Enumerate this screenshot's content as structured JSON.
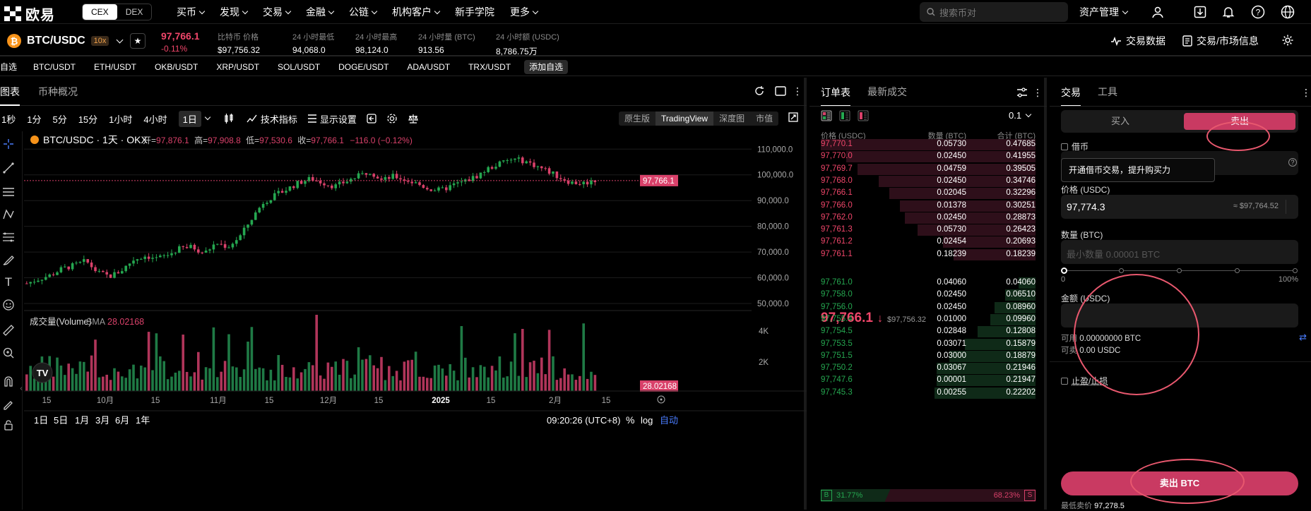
{
  "topbar": {
    "brand": "欧易",
    "cex": "CEX",
    "dex": "DEX",
    "nav": [
      "买币",
      "发现",
      "交易",
      "金融",
      "公链",
      "机构客户",
      "新手学院",
      "更多"
    ],
    "nav_has_chevron": [
      true,
      true,
      true,
      true,
      true,
      true,
      false,
      true
    ],
    "search_placeholder": "搜索币对",
    "asset_menu": "资产管理"
  },
  "ticker": {
    "pair": "BTC/USDC",
    "leverage": "10x",
    "last_price": "97,766.1",
    "change": "-0.11%",
    "stats": [
      {
        "label": "比特币 价格",
        "value": "$97,756.32"
      },
      {
        "label": "24 小时最低",
        "value": "94,068.0"
      },
      {
        "label": "24 小时最高",
        "value": "98,124.0"
      },
      {
        "label": "24 小时量 (BTC)",
        "value": "913.56"
      },
      {
        "label": "24 小时额 (USDC)",
        "value": "8,786.75万"
      }
    ],
    "trade_data": "交易数据",
    "trade_info": "交易/市场信息"
  },
  "watchlist": {
    "label": "自选",
    "pairs": [
      "BTC/USDT",
      "ETH/USDT",
      "OKB/USDT",
      "XRP/USDT",
      "SOL/USDT",
      "DOGE/USDT",
      "ADA/USDT",
      "TRX/USDT"
    ],
    "add": "添加自选"
  },
  "chart": {
    "tabs": [
      "图表",
      "币种概况"
    ],
    "timeframes": [
      "1秒",
      "1分",
      "5分",
      "15分",
      "1小时",
      "4小时"
    ],
    "active_timeframe": "1日",
    "indicators": "技术指标",
    "display_settings": "显示设置",
    "views": [
      "原生版",
      "TradingView",
      "深度图",
      "市值"
    ],
    "active_view": "TradingView",
    "legend": {
      "symbol": "BTC/USDC · 1天 · OKX",
      "open_label": "开=",
      "open": "97,876.1",
      "high_label": "高=",
      "high": "97,908.8",
      "low_label": "低=",
      "low": "97,530.6",
      "close_label": "收=",
      "close": "97,766.1",
      "change": "−116.0 (−0.12%)"
    },
    "volume_label": "成交量(Volume)",
    "volume_sma_label": "SMA",
    "volume_sma": "28.02168",
    "price_label": "97,766.1",
    "y_ticks": [
      "110,000.0",
      "100,000.0",
      "90,000.0",
      "80,000.0",
      "70,000.0",
      "60,000.0",
      "50,000.0"
    ],
    "vol_ticks": [
      "4K",
      "2K"
    ],
    "x_ticks": [
      "15",
      "10月",
      "15",
      "11月",
      "15",
      "12月",
      "15",
      "2025",
      "15",
      "2月",
      "15"
    ],
    "ranges": [
      "1日",
      "5日",
      "1月",
      "3月",
      "6月",
      "1年"
    ],
    "clock": "09:20:26 (UTC+8)",
    "percent": "%",
    "log": "log",
    "auto": "自动"
  },
  "chart_data": {
    "type": "candlestick",
    "title": "BTC/USDC · 1天 · OKX",
    "ylim": [
      50000,
      112000
    ],
    "x_range": [
      "2024-09",
      "2025-02"
    ],
    "approx_close_path": [
      57800,
      59500,
      61000,
      63500,
      64800,
      66500,
      62000,
      60500,
      62800,
      67000,
      68500,
      67500,
      69000,
      71500,
      72000,
      69500,
      73500,
      72000,
      76000,
      83000,
      89500,
      92000,
      94500,
      97000,
      98500,
      97000,
      95500,
      97500,
      99500,
      101500,
      97800,
      99500,
      98000,
      96500,
      94500,
      94000,
      96000,
      97500,
      99500,
      102500,
      104500,
      106000,
      105500,
      103500,
      101500,
      99000,
      97000,
      96800,
      97766
    ],
    "volume_color_up": "#1f7a45",
    "volume_color_down": "#b0355a",
    "up_color": "#25a750",
    "down_color": "#d9416a"
  },
  "orderbook": {
    "tabs": [
      "订单表",
      "最新成交"
    ],
    "precision": "0.1",
    "headers": [
      "价格 (USDC)",
      "数量 (BTC)",
      "合计 (BTC)"
    ],
    "asks": [
      [
        "97,770.1",
        "0.05730",
        "0.47685"
      ],
      [
        "97,770.0",
        "0.02450",
        "0.41955"
      ],
      [
        "97,769.7",
        "0.04759",
        "0.39505"
      ],
      [
        "97,768.0",
        "0.02450",
        "0.34746"
      ],
      [
        "97,766.1",
        "0.02045",
        "0.32296"
      ],
      [
        "97,766.0",
        "0.01378",
        "0.30251"
      ],
      [
        "97,762.0",
        "0.02450",
        "0.28873"
      ],
      [
        "97,761.3",
        "0.05730",
        "0.26423"
      ],
      [
        "97,761.2",
        "0.02454",
        "0.20693"
      ],
      [
        "97,761.1",
        "0.18239",
        "0.18239"
      ]
    ],
    "ask_depth": [
      1.0,
      0.88,
      0.83,
      0.73,
      0.68,
      0.63,
      0.61,
      0.55,
      0.43,
      0.38
    ],
    "mid_price": "97,766.1",
    "mid_usd": "$97,756.32",
    "bids": [
      [
        "97,761.0",
        "0.04060",
        "0.04060"
      ],
      [
        "97,758.0",
        "0.02450",
        "0.06510"
      ],
      [
        "97,756.0",
        "0.02450",
        "0.08960"
      ],
      [
        "97,755.4",
        "0.01000",
        "0.09960"
      ],
      [
        "97,754.5",
        "0.02848",
        "0.12808"
      ],
      [
        "97,753.5",
        "0.03071",
        "0.15879"
      ],
      [
        "97,751.5",
        "0.03000",
        "0.18879"
      ],
      [
        "97,750.2",
        "0.03067",
        "0.21946"
      ],
      [
        "97,747.6",
        "0.00001",
        "0.21947"
      ],
      [
        "97,745.3",
        "0.00255",
        "0.22202"
      ]
    ],
    "bid_depth": [
      0.08,
      0.14,
      0.19,
      0.21,
      0.27,
      0.33,
      0.4,
      0.46,
      0.46,
      0.47
    ],
    "buy_tag": "B",
    "buy_ratio": "31.77%",
    "sell_ratio": "68.23%",
    "sell_tag": "S",
    "buy_fraction": 0.3177
  },
  "trade": {
    "tabs": [
      "交易",
      "工具"
    ],
    "buy": "买入",
    "sell": "卖出",
    "borrow": "借币",
    "borrow_tip": "开通借币交易，提升购买力",
    "price_label": "价格 (USDC)",
    "price_value": "97,774.3",
    "price_usd": "≈ $97,764.52",
    "qty_label": "数量 (BTC)",
    "qty_placeholder": "最小数量 0.00001 BTC",
    "slider_min": "0",
    "slider_max": "100%",
    "slider_level": 0,
    "amount_label": "金额 (USDC)",
    "available_label": "可用",
    "available_value": "0.00000000 BTC",
    "sellable_label": "可卖",
    "sellable_value": "0.00 USDC",
    "tpsl": "止盈/止损",
    "sell_button": "卖出 BTC",
    "min_sell_label": "最低卖价",
    "min_sell_value": "97,278.5"
  }
}
